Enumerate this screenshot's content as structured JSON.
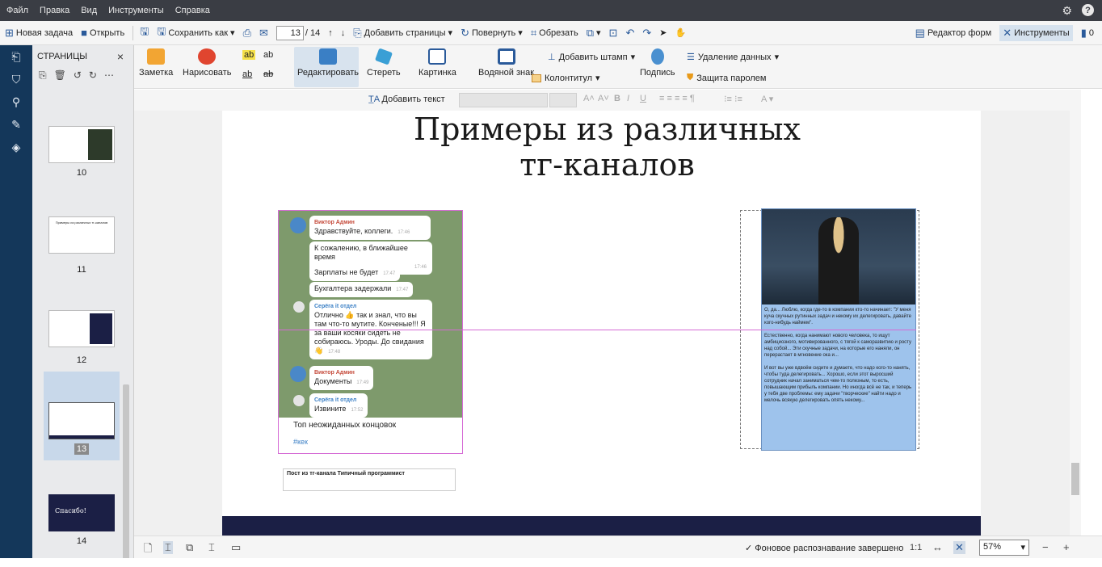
{
  "menubar": {
    "items": [
      "Файл",
      "Правка",
      "Вид",
      "Инструменты",
      "Справка"
    ]
  },
  "toolbar": {
    "new_task": "Новая задача",
    "open": "Открыть",
    "save_as": "Сохранить как",
    "page_current": "13",
    "page_total": "/ 14",
    "add_pages": "Добавить страницы",
    "rotate": "Повернуть",
    "crop": "Обрезать",
    "form_editor": "Редактор форм",
    "tools": "Инструменты",
    "comments_count": "0"
  },
  "panel": {
    "title": "СТРАНИЦЫ",
    "pages": [
      "10",
      "11",
      "12",
      "13",
      "14"
    ],
    "thumb_11_text": "Примеры из различных тг-каналов",
    "thumb_14_text": "Спасибо!"
  },
  "ribbon": {
    "note": "Заметка",
    "draw": "Нарисовать",
    "edit": "Редактировать",
    "erase": "Стереть",
    "picture": "Картинка",
    "watermark": "Водяной знак",
    "add_stamp": "Добавить штамп",
    "header_footer": "Колонтитул",
    "signature": "Подпись",
    "redaction": "Удаление данных",
    "password": "Защита паролем"
  },
  "fmtbar": {
    "add_text": "Добавить текст"
  },
  "slide": {
    "title_line1": "Примеры из различных",
    "title_line2": "тг-каналов",
    "caption": "Пост из тг-канала Типичный программист"
  },
  "telegram": {
    "messages": [
      {
        "name": "Виктор Админ",
        "text": "Здравствуйте, коллеги.",
        "time": "17:46"
      },
      {
        "text": "К сожалению, в ближайшее время",
        "time": "17:46"
      },
      {
        "text": "Зарплаты не будет",
        "time": "17:47"
      },
      {
        "text": "Бухгалтера задержали",
        "time": "17:47"
      },
      {
        "name": "Серёга it отдел",
        "text": "Отлично 👍 так и знал, что вы там что-то мутите. Конченые!!! Я за ваши косяки сидеть не собираюсь. Уроды. До свидания 👋",
        "time": "17:48"
      },
      {
        "name": "Виктор Админ",
        "text": "Документы",
        "time": "17:49"
      },
      {
        "name": "Серёга it отдел",
        "text": "Извините",
        "time": "17:52"
      }
    ],
    "footer_text": "Топ неожиданных концовок",
    "footer_tag": "#кек"
  },
  "meme": {
    "p1": "О, да... Люблю, когда где-то в компании кто-то начинает: \"У меня куча скучных рутинных задач и некому их делегировать, давайте кого-нибудь наймем\".",
    "p2": "Естественно, когда нанимают нового человека, то ищут амбициозного, мотивированного, с тягой к саморазвитию и росту над собой... Эти скучные задачи, на которые его наняли, он перерастает в мгновение ока и...",
    "p3": "И вот вы уже вдвоём сидите и думаете, что надо кого-то нанять, чтобы туда делегировать... Хорошо, если этот выросший сотрудник начал заниматься чем-то полезным, то есть, повышающим прибыль компании. Но иногда всё не так, и теперь у тебя две проблемы: ему задачи \"творческие\" найти надо и мелочь всякую делегировать опять некому..."
  },
  "status": {
    "ocr_text": "Фоновое распознавание завершено",
    "ratio": "1:1",
    "zoom": "57%"
  }
}
